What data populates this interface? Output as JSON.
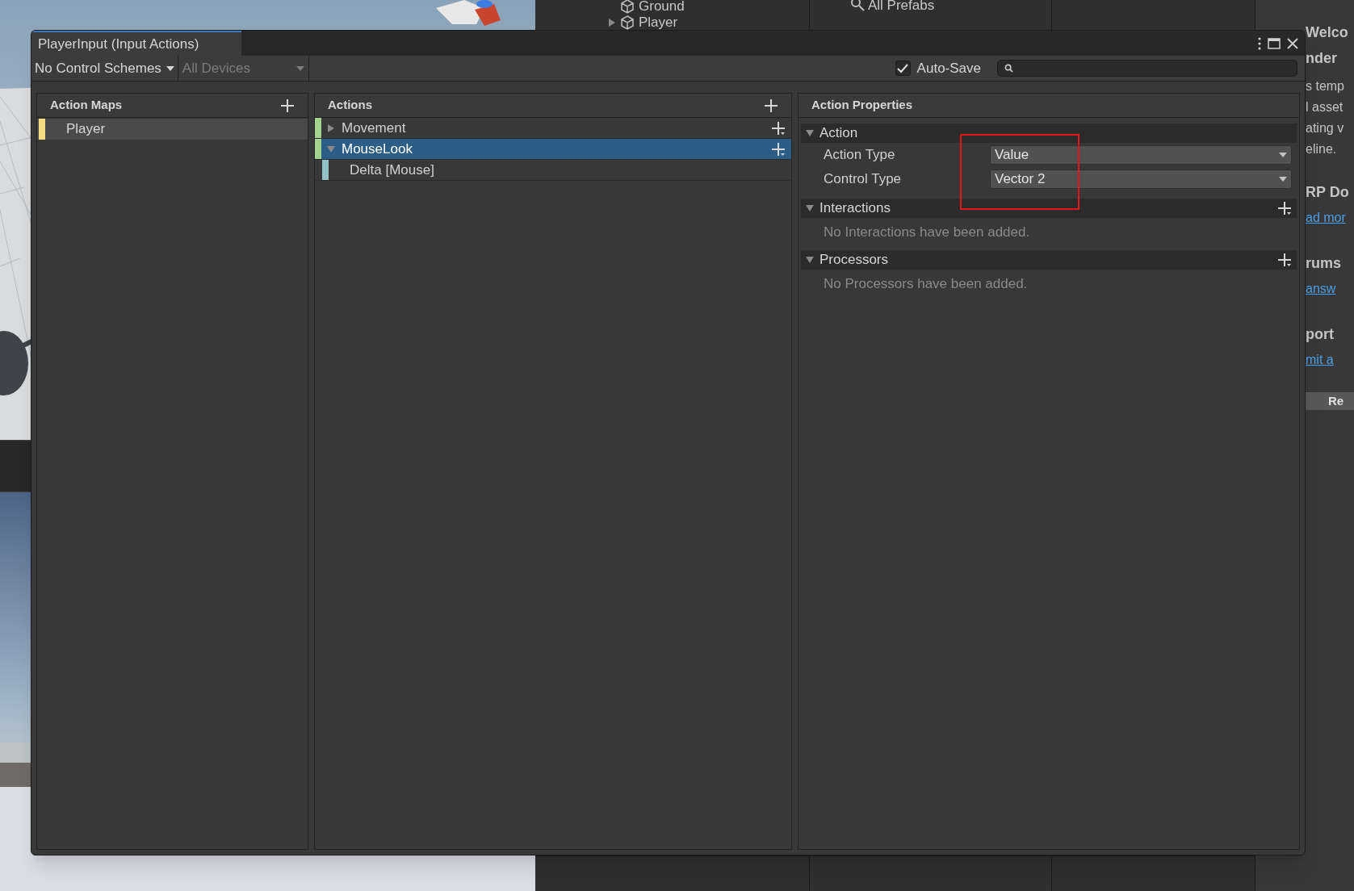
{
  "background": {
    "hierarchy": [
      {
        "label": "Ground",
        "expandable": false
      },
      {
        "label": "Player",
        "expandable": true
      }
    ],
    "project_search": "All Prefabs",
    "welcome_panel": [
      {
        "kind": "heading",
        "text": "Welco"
      },
      {
        "kind": "heading",
        "text": "nder"
      },
      {
        "kind": "body",
        "text": "s temp"
      },
      {
        "kind": "body",
        "text": "l asset"
      },
      {
        "kind": "body",
        "text": "ating v"
      },
      {
        "kind": "body",
        "text": "eline."
      },
      {
        "kind": "heading",
        "text": "RP Do"
      },
      {
        "kind": "link",
        "text": "ad mor"
      },
      {
        "kind": "heading",
        "text": "rums"
      },
      {
        "kind": "link",
        "text": "answ"
      },
      {
        "kind": "heading",
        "text": "port"
      },
      {
        "kind": "link",
        "text": "mit a"
      },
      {
        "kind": "button",
        "text": "Re"
      }
    ]
  },
  "window": {
    "title": "PlayerInput (Input Actions)"
  },
  "toolbar": {
    "control_scheme": "No Control Schemes",
    "devices": {
      "label": "All Devices",
      "disabled": true
    },
    "auto_save": {
      "label": "Auto-Save",
      "checked": true
    }
  },
  "action_maps": {
    "title": "Action Maps",
    "items": [
      {
        "label": "Player",
        "color": "#f4dc82",
        "selected": true
      }
    ]
  },
  "actions": {
    "title": "Actions",
    "items": [
      {
        "label": "Movement",
        "color": "#a3d48f",
        "expanded": false,
        "selected": false
      },
      {
        "label": "MouseLook",
        "color": "#a3d48f",
        "expanded": true,
        "selected": true,
        "children": [
          {
            "label": "Delta [Mouse]",
            "color": "#93c1c6",
            "selected": false
          }
        ]
      }
    ]
  },
  "properties": {
    "title": "Action Properties",
    "sections": [
      {
        "title": "Action",
        "expanded": true,
        "addable": false,
        "fields": [
          {
            "label": "Action Type",
            "value": "Value"
          },
          {
            "label": "Control Type",
            "value": "Vector 2"
          }
        ]
      },
      {
        "title": "Interactions",
        "expanded": true,
        "addable": true,
        "empty_text": "No Interactions have been added."
      },
      {
        "title": "Processors",
        "expanded": true,
        "addable": true,
        "empty_text": "No Processors have been added."
      }
    ]
  }
}
